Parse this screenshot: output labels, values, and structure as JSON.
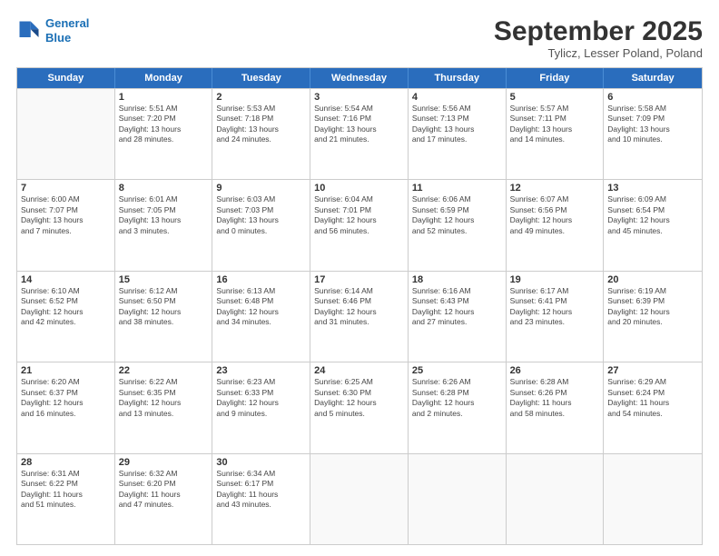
{
  "logo": {
    "line1": "General",
    "line2": "Blue"
  },
  "title": "September 2025",
  "location": "Tylicz, Lesser Poland, Poland",
  "days_header": [
    "Sunday",
    "Monday",
    "Tuesday",
    "Wednesday",
    "Thursday",
    "Friday",
    "Saturday"
  ],
  "weeks": [
    [
      {
        "day": "",
        "info": ""
      },
      {
        "day": "1",
        "info": "Sunrise: 5:51 AM\nSunset: 7:20 PM\nDaylight: 13 hours\nand 28 minutes."
      },
      {
        "day": "2",
        "info": "Sunrise: 5:53 AM\nSunset: 7:18 PM\nDaylight: 13 hours\nand 24 minutes."
      },
      {
        "day": "3",
        "info": "Sunrise: 5:54 AM\nSunset: 7:16 PM\nDaylight: 13 hours\nand 21 minutes."
      },
      {
        "day": "4",
        "info": "Sunrise: 5:56 AM\nSunset: 7:13 PM\nDaylight: 13 hours\nand 17 minutes."
      },
      {
        "day": "5",
        "info": "Sunrise: 5:57 AM\nSunset: 7:11 PM\nDaylight: 13 hours\nand 14 minutes."
      },
      {
        "day": "6",
        "info": "Sunrise: 5:58 AM\nSunset: 7:09 PM\nDaylight: 13 hours\nand 10 minutes."
      }
    ],
    [
      {
        "day": "7",
        "info": "Sunrise: 6:00 AM\nSunset: 7:07 PM\nDaylight: 13 hours\nand 7 minutes."
      },
      {
        "day": "8",
        "info": "Sunrise: 6:01 AM\nSunset: 7:05 PM\nDaylight: 13 hours\nand 3 minutes."
      },
      {
        "day": "9",
        "info": "Sunrise: 6:03 AM\nSunset: 7:03 PM\nDaylight: 13 hours\nand 0 minutes."
      },
      {
        "day": "10",
        "info": "Sunrise: 6:04 AM\nSunset: 7:01 PM\nDaylight: 12 hours\nand 56 minutes."
      },
      {
        "day": "11",
        "info": "Sunrise: 6:06 AM\nSunset: 6:59 PM\nDaylight: 12 hours\nand 52 minutes."
      },
      {
        "day": "12",
        "info": "Sunrise: 6:07 AM\nSunset: 6:56 PM\nDaylight: 12 hours\nand 49 minutes."
      },
      {
        "day": "13",
        "info": "Sunrise: 6:09 AM\nSunset: 6:54 PM\nDaylight: 12 hours\nand 45 minutes."
      }
    ],
    [
      {
        "day": "14",
        "info": "Sunrise: 6:10 AM\nSunset: 6:52 PM\nDaylight: 12 hours\nand 42 minutes."
      },
      {
        "day": "15",
        "info": "Sunrise: 6:12 AM\nSunset: 6:50 PM\nDaylight: 12 hours\nand 38 minutes."
      },
      {
        "day": "16",
        "info": "Sunrise: 6:13 AM\nSunset: 6:48 PM\nDaylight: 12 hours\nand 34 minutes."
      },
      {
        "day": "17",
        "info": "Sunrise: 6:14 AM\nSunset: 6:46 PM\nDaylight: 12 hours\nand 31 minutes."
      },
      {
        "day": "18",
        "info": "Sunrise: 6:16 AM\nSunset: 6:43 PM\nDaylight: 12 hours\nand 27 minutes."
      },
      {
        "day": "19",
        "info": "Sunrise: 6:17 AM\nSunset: 6:41 PM\nDaylight: 12 hours\nand 23 minutes."
      },
      {
        "day": "20",
        "info": "Sunrise: 6:19 AM\nSunset: 6:39 PM\nDaylight: 12 hours\nand 20 minutes."
      }
    ],
    [
      {
        "day": "21",
        "info": "Sunrise: 6:20 AM\nSunset: 6:37 PM\nDaylight: 12 hours\nand 16 minutes."
      },
      {
        "day": "22",
        "info": "Sunrise: 6:22 AM\nSunset: 6:35 PM\nDaylight: 12 hours\nand 13 minutes."
      },
      {
        "day": "23",
        "info": "Sunrise: 6:23 AM\nSunset: 6:33 PM\nDaylight: 12 hours\nand 9 minutes."
      },
      {
        "day": "24",
        "info": "Sunrise: 6:25 AM\nSunset: 6:30 PM\nDaylight: 12 hours\nand 5 minutes."
      },
      {
        "day": "25",
        "info": "Sunrise: 6:26 AM\nSunset: 6:28 PM\nDaylight: 12 hours\nand 2 minutes."
      },
      {
        "day": "26",
        "info": "Sunrise: 6:28 AM\nSunset: 6:26 PM\nDaylight: 11 hours\nand 58 minutes."
      },
      {
        "day": "27",
        "info": "Sunrise: 6:29 AM\nSunset: 6:24 PM\nDaylight: 11 hours\nand 54 minutes."
      }
    ],
    [
      {
        "day": "28",
        "info": "Sunrise: 6:31 AM\nSunset: 6:22 PM\nDaylight: 11 hours\nand 51 minutes."
      },
      {
        "day": "29",
        "info": "Sunrise: 6:32 AM\nSunset: 6:20 PM\nDaylight: 11 hours\nand 47 minutes."
      },
      {
        "day": "30",
        "info": "Sunrise: 6:34 AM\nSunset: 6:17 PM\nDaylight: 11 hours\nand 43 minutes."
      },
      {
        "day": "",
        "info": ""
      },
      {
        "day": "",
        "info": ""
      },
      {
        "day": "",
        "info": ""
      },
      {
        "day": "",
        "info": ""
      }
    ]
  ]
}
